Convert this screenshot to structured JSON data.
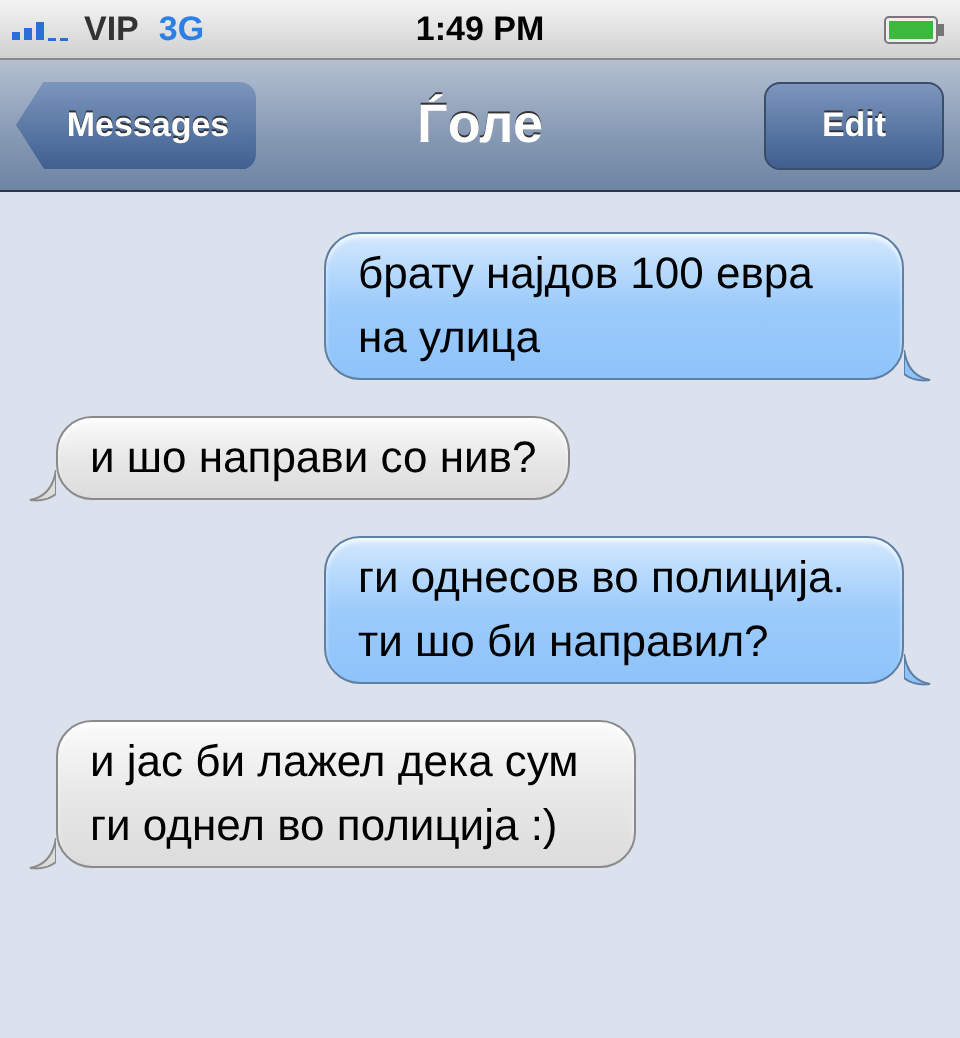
{
  "status_bar": {
    "carrier": "VIP",
    "network": "3G",
    "time": "1:49 PM"
  },
  "nav_bar": {
    "back_button": "Messages",
    "title": "Ѓоле",
    "edit_button": "Edit"
  },
  "messages": [
    {
      "kind": "sent",
      "text": "брату најдов 100 евра на улица"
    },
    {
      "kind": "received",
      "text": "и шо направи со нив?"
    },
    {
      "kind": "sent",
      "text": "ги однесов во полиција. ти шо би направил?"
    },
    {
      "kind": "received",
      "text": "и јас би лажел дека сум ги однел во полиција :)"
    }
  ]
}
